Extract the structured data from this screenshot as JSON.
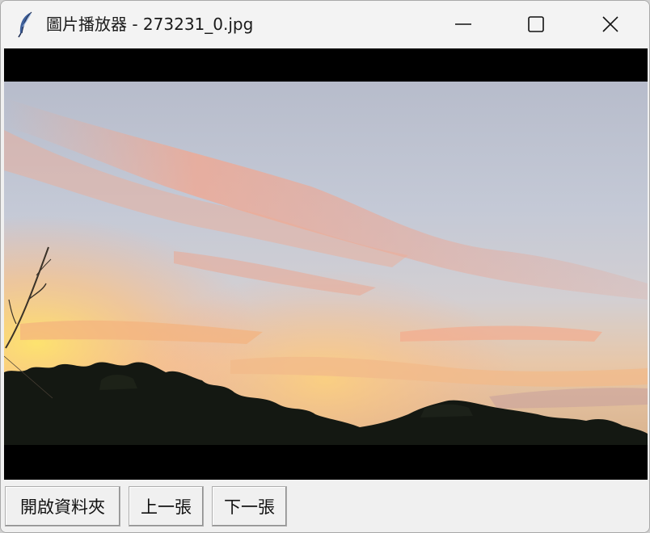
{
  "window": {
    "title": "圖片播放器 - 273231_0.jpg",
    "icons": {
      "app": "feather-icon",
      "minimize": "minimize-icon",
      "maximize": "maximize-icon",
      "close": "close-icon"
    }
  },
  "viewer": {
    "image_description_icon": "photo-sunset-sky",
    "background_color": "#000000"
  },
  "toolbar": {
    "open_folder_label": "開啟資料夾",
    "previous_label": "上一張",
    "next_label": "下一張"
  }
}
